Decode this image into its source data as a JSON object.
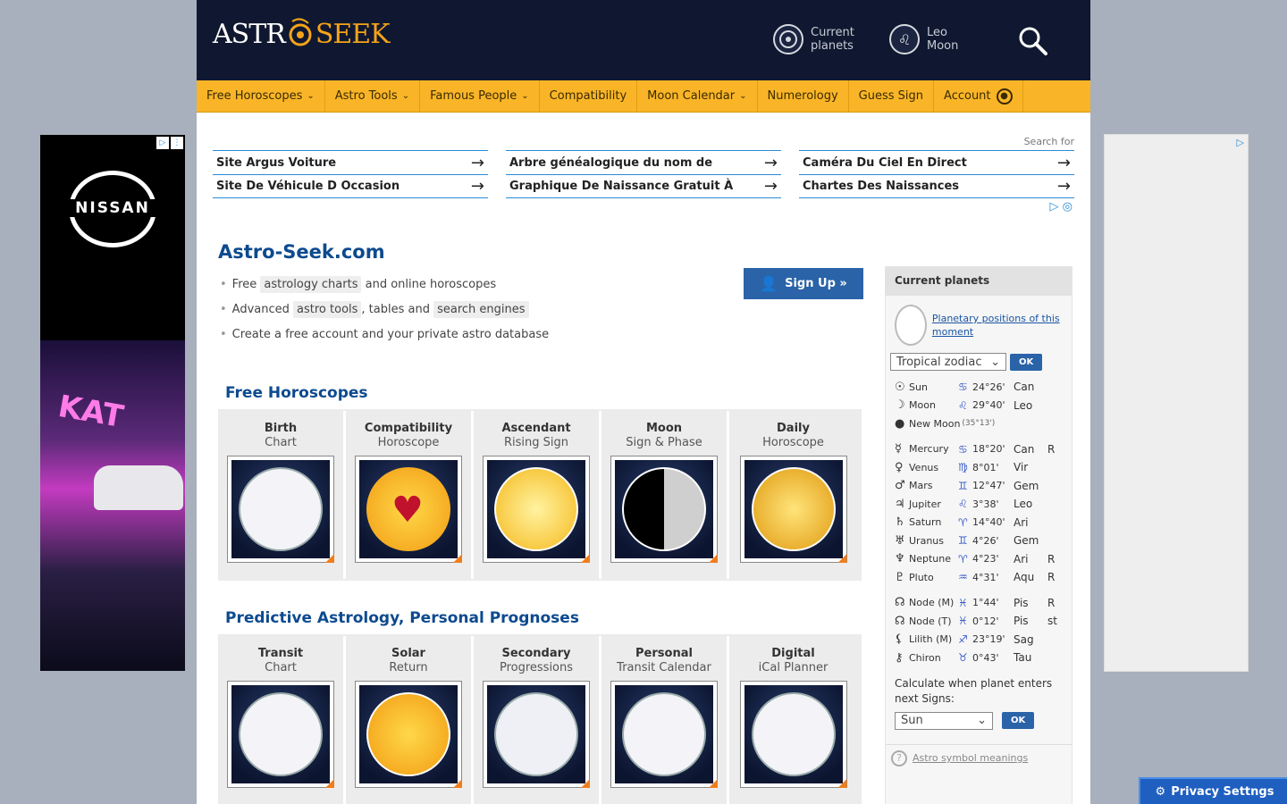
{
  "header": {
    "logo_left": "ASTR",
    "logo_right": "SEEK",
    "links": [
      {
        "line1": "Current",
        "line2": "planets"
      },
      {
        "line1": "Leo",
        "line2": "Moon"
      }
    ]
  },
  "nav": [
    {
      "label": "Free Horoscopes",
      "chevron": true
    },
    {
      "label": "Astro Tools",
      "chevron": true
    },
    {
      "label": "Famous People",
      "chevron": true
    },
    {
      "label": "Compatibility",
      "chevron": false
    },
    {
      "label": "Moon Calendar",
      "chevron": true
    },
    {
      "label": "Numerology",
      "chevron": false
    },
    {
      "label": "Guess Sign",
      "chevron": false
    },
    {
      "label": "Account",
      "chevron": false
    }
  ],
  "ads": {
    "search_for": "Search for",
    "links": [
      [
        "Site Argus Voiture",
        "Site De Véhicule D Occasion"
      ],
      [
        "Arbre généalogique du nom de",
        "Graphique De Naissance Gratuit À"
      ],
      [
        "Caméra Du Ciel En Direct",
        "Chartes Des Naissances"
      ]
    ],
    "left_brand": "NISSAN"
  },
  "main": {
    "title": "Astro-Seek.com",
    "signup": "Sign Up »",
    "bullets": [
      {
        "pre": "Free",
        "tag": "astrology charts",
        "post": "and online horoscopes"
      },
      {
        "pre": "Advanced",
        "tag": "astro tools",
        "mid": ", tables and",
        "tag2": "search engines"
      },
      {
        "pre": "Create a free account and your private astro database"
      }
    ],
    "sections": [
      {
        "title": "Free Horoscopes",
        "items": [
          {
            "t1": "Birth",
            "t2": "Chart"
          },
          {
            "t1": "Compatibility",
            "t2": "Horoscope"
          },
          {
            "t1": "Ascendant",
            "t2": "Rising Sign"
          },
          {
            "t1": "Moon",
            "t2": "Sign & Phase"
          },
          {
            "t1": "Daily",
            "t2": "Horoscope"
          }
        ]
      },
      {
        "title": "Predictive Astrology, Personal Prognoses",
        "items": [
          {
            "t1": "Transit",
            "t2": "Chart"
          },
          {
            "t1": "Solar",
            "t2": "Return"
          },
          {
            "t1": "Secondary",
            "t2": "Progressions"
          },
          {
            "t1": "Personal",
            "t2": "Transit Calendar"
          },
          {
            "t1": "Digital",
            "t2": "iCal Planner"
          }
        ]
      }
    ]
  },
  "sidebar": {
    "heading": "Current planets",
    "link": "Planetary positions of this moment",
    "zodiac": "Tropical zodiac",
    "ok": "OK",
    "planets": [
      {
        "g": "☉",
        "name": "Sun",
        "sg": "♋",
        "deg": "24°26'",
        "sign": "Can",
        "r": ""
      },
      {
        "g": "☽",
        "name": "Moon",
        "sg": "♌",
        "deg": "29°40'",
        "sign": "Leo",
        "r": ""
      },
      {
        "g": "●",
        "name": "New Moon",
        "extra": "(35°13')"
      },
      {
        "gap": true
      },
      {
        "g": "☿",
        "name": "Mercury",
        "sg": "♋",
        "deg": "18°20'",
        "sign": "Can",
        "r": "R"
      },
      {
        "g": "♀",
        "name": "Venus",
        "sg": "♍",
        "deg": "8°01'",
        "sign": "Vir",
        "r": ""
      },
      {
        "g": "♂",
        "name": "Mars",
        "sg": "♊",
        "deg": "12°47'",
        "sign": "Gem",
        "r": ""
      },
      {
        "g": "♃",
        "name": "Jupiter",
        "sg": "♌",
        "deg": "3°38'",
        "sign": "Leo",
        "r": ""
      },
      {
        "g": "♄",
        "name": "Saturn",
        "sg": "♈",
        "deg": "14°40'",
        "sign": "Ari",
        "r": ""
      },
      {
        "g": "♅",
        "name": "Uranus",
        "sg": "♊",
        "deg": "4°26'",
        "sign": "Gem",
        "r": ""
      },
      {
        "g": "♆",
        "name": "Neptune",
        "sg": "♈",
        "deg": "4°23'",
        "sign": "Ari",
        "r": "R"
      },
      {
        "g": "♇",
        "name": "Pluto",
        "sg": "♒",
        "deg": "4°31'",
        "sign": "Aqu",
        "r": "R"
      },
      {
        "gap": true
      },
      {
        "g": "☊",
        "name": "Node (M)",
        "sg": "♓",
        "deg": "1°44'",
        "sign": "Pis",
        "r": "R"
      },
      {
        "g": "☊",
        "name": "Node (T)",
        "sg": "♓",
        "deg": "0°12'",
        "sign": "Pis",
        "r": "st"
      },
      {
        "g": "⚸",
        "name": "Lilith (M)",
        "sg": "♐",
        "deg": "23°19'",
        "sign": "Sag",
        "r": ""
      },
      {
        "g": "⚷",
        "name": "Chiron",
        "sg": "♉",
        "deg": "0°43'",
        "sign": "Tau",
        "r": ""
      }
    ],
    "calc_text": "Calculate when planet enters next Signs:",
    "calc_select": "Sun",
    "symbols_link": "Astro symbol meanings"
  },
  "privacy": "Privacy Settngs"
}
